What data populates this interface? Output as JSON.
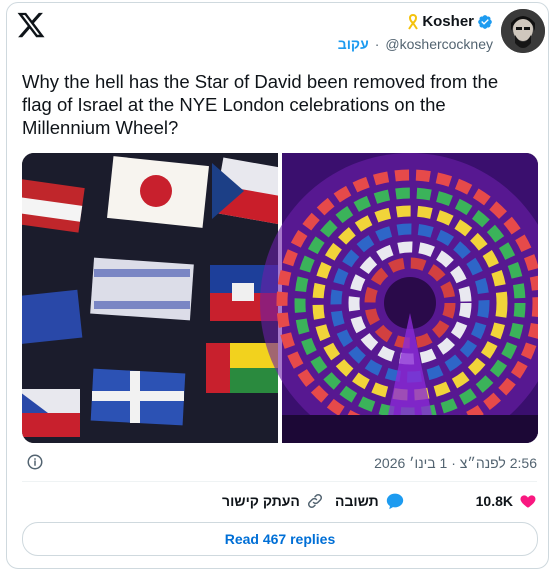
{
  "header": {
    "display_name": "Kosher",
    "handle": "@koshercockney",
    "follow_label": "עקוב",
    "separator": "·"
  },
  "tweet": {
    "text": "Why the hell has the Star of David been removed from the flag of Israel at the NYE London celebrations on the Millennium Wheel?",
    "timestamp": "2:56 לפנה״צ · 1 בינו׳ 2026"
  },
  "actions": {
    "likes_count": "10.8K",
    "reply_label": "תשובה",
    "copy_link_label": "העתק קישור"
  },
  "footer": {
    "read_replies_label": "Read 467 replies"
  },
  "colors": {
    "accent": "#1d9bf0",
    "like": "#f91880",
    "link_text": "#006fd6",
    "muted": "#536471"
  }
}
